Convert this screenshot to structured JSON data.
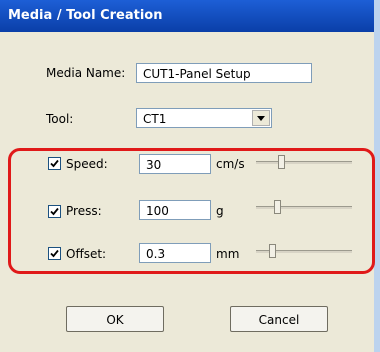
{
  "window": {
    "title": "Media / Tool Creation"
  },
  "media_name": {
    "label": "Media Name:",
    "value": "CUT1-Panel Setup"
  },
  "tool": {
    "label": "Tool:",
    "selected": "CT1"
  },
  "speed": {
    "label": "Speed:",
    "checked": true,
    "value": "30",
    "unit": "cm/s",
    "slider_fraction": 0.25
  },
  "press": {
    "label": "Press:",
    "checked": true,
    "value": "100",
    "unit": "g",
    "slider_fraction": 0.2
  },
  "offset": {
    "label": "Offset:",
    "checked": true,
    "value": "0.3",
    "unit": "mm",
    "slider_fraction": 0.15
  },
  "buttons": {
    "ok": "OK",
    "cancel": "Cancel"
  },
  "colors": {
    "title_bar": "#0a3fa8",
    "dialog_bg": "#ece9d8",
    "highlight": "#e01919"
  }
}
